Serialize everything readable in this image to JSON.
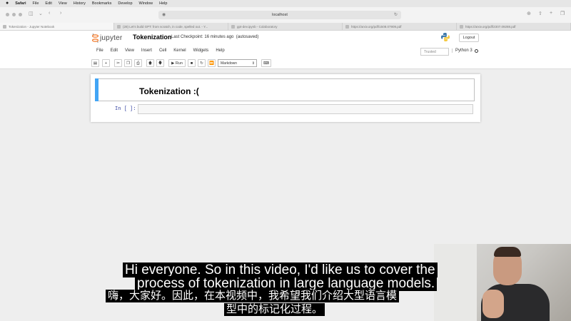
{
  "mac_menubar": {
    "app": "Safari",
    "items": [
      "File",
      "Edit",
      "View",
      "History",
      "Bookmarks",
      "Develop",
      "Window",
      "Help"
    ]
  },
  "browser": {
    "address": "localhost",
    "tabs": [
      {
        "label": "Tokenization - Jupyter Notebook",
        "active": true
      },
      {
        "label": "(28) Let's build GPT: from scratch, in code, spelled out. - Y...",
        "active": false
      },
      {
        "label": "gpt-dev.ipynb - Colaboratory",
        "active": false
      },
      {
        "label": "https://arxiv.org/pdf/1508.07909.pdf",
        "active": false
      },
      {
        "label": "https://arxiv.org/pdf/2307.09288.pdf",
        "active": false
      }
    ]
  },
  "jupyter": {
    "logo_text": "jupyter",
    "notebook_title": "Tokenization",
    "checkpoint": "Last Checkpoint: 16 minutes ago",
    "autosave": "(autosaved)",
    "logout": "Logout",
    "menu": [
      "File",
      "Edit",
      "View",
      "Insert",
      "Cell",
      "Kernel",
      "Widgets",
      "Help"
    ],
    "trusted": "Trusted",
    "kernel": "Python 3",
    "toolbar": {
      "run_label": "Run",
      "cell_type": "Markdown"
    }
  },
  "notebook": {
    "heading": "Tokenization :(",
    "prompt": "In [ ]:"
  },
  "subtitles": {
    "en_line1": "Hi everyone. So in this video, I'd like us to cover the",
    "en_line2": "process of tokenization in large language models.",
    "zh_line1": "嗨，大家好。因此，在本视频中，我希望我们介绍大型语言模",
    "zh_line2": "型中的标记化过程。"
  },
  "colors": {
    "cell_selected_border": "#42a5f5",
    "prompt_color": "#303f9f",
    "subtitle_bg": "#000000",
    "subtitle_text": "#ffffff"
  }
}
